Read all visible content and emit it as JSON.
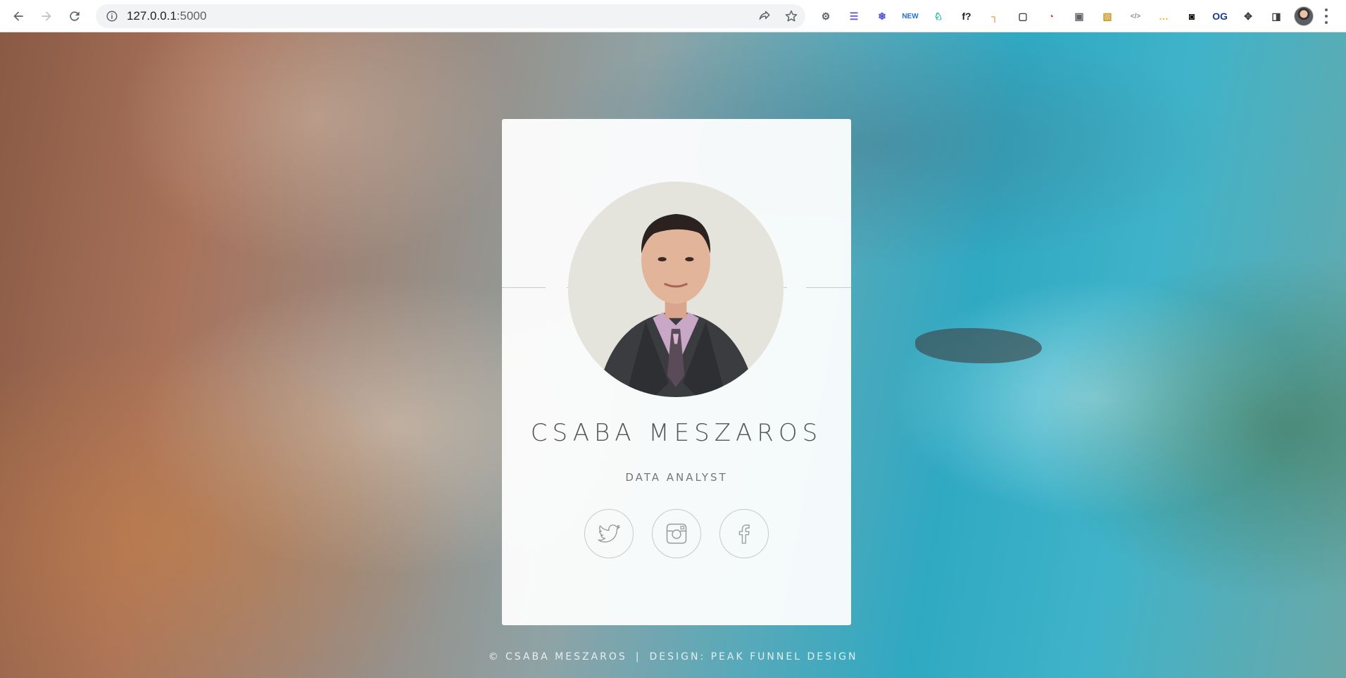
{
  "browser": {
    "url_host": "127.0.0.1",
    "url_port": ":5000",
    "extensions": [
      {
        "icon": "bug-icon",
        "glyph": "⚙",
        "color": "#5f6368"
      },
      {
        "icon": "stack-icon",
        "glyph": "☰",
        "color": "#6a5acd"
      },
      {
        "icon": "snowflake-icon",
        "glyph": "❄",
        "color": "#4b4bd6"
      },
      {
        "icon": "new-badge-icon",
        "glyph": "NEW",
        "color": "#1e6fd9"
      },
      {
        "icon": "pegasus-icon",
        "glyph": "♘",
        "color": "#12b5a5"
      },
      {
        "icon": "function-icon",
        "glyph": "f?",
        "color": "#202124"
      },
      {
        "icon": "ruler-icon",
        "glyph": "┐",
        "color": "#e08a1e"
      },
      {
        "icon": "capture-icon",
        "glyph": "▢",
        "color": "#3c4043"
      },
      {
        "icon": "color-wheel-icon",
        "glyph": "◔",
        "color": "#e8453c"
      },
      {
        "icon": "camera-icon",
        "glyph": "▣",
        "color": "#5f6368"
      },
      {
        "icon": "image-icon",
        "glyph": "▧",
        "color": "#c99a2e"
      },
      {
        "icon": "code-icon",
        "glyph": "</>",
        "color": "#8a8a8a"
      },
      {
        "icon": "dots-icon",
        "glyph": "…",
        "color": "#e8b923"
      },
      {
        "icon": "mask-icon",
        "glyph": "◙",
        "color": "#000000"
      },
      {
        "icon": "og-icon",
        "glyph": "OG",
        "color": "#1a3c8f"
      },
      {
        "icon": "puzzle-icon",
        "glyph": "✥",
        "color": "#3c4043"
      },
      {
        "icon": "sidepanel-icon",
        "glyph": "◨",
        "color": "#3c4043"
      }
    ]
  },
  "profile": {
    "name": "CSABA MESZAROS",
    "role": "DATA ANALYST",
    "socials": [
      {
        "name": "twitter",
        "icon": "twitter-icon"
      },
      {
        "name": "instagram",
        "icon": "instagram-icon"
      },
      {
        "name": "facebook",
        "icon": "facebook-icon"
      }
    ]
  },
  "footer": {
    "copyright": "© CSABA MESZAROS",
    "separator": "|",
    "design": "DESIGN: PEAK FUNNEL DESIGN"
  }
}
